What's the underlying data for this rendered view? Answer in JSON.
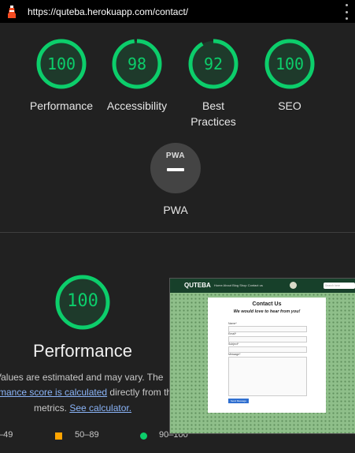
{
  "topbar": {
    "url": "https://quteba.herokuapp.com/contact/",
    "icon": "lighthouse-icon",
    "menu_icon": "kebab-menu-icon"
  },
  "gauges": [
    {
      "score": "100",
      "label": "Performance"
    },
    {
      "score": "98",
      "label": "Accessibility"
    },
    {
      "score": "92",
      "label_line1": "Best",
      "label_line2": "Practices"
    },
    {
      "score": "100",
      "label": "SEO"
    }
  ],
  "pwa": {
    "badge": "PWA",
    "label": "PWA"
  },
  "performance": {
    "score": "100",
    "title": "Performance",
    "note_line1": "Values are estimated and may vary. The",
    "note_line2_link": "mance score is calculated",
    "note_line2_rest": " directly from th",
    "note_line3_pre": "metrics. ",
    "note_line3_link": "See calculator."
  },
  "legend": {
    "fail": "–49",
    "average": "50–89",
    "pass": "90–100"
  },
  "colors": {
    "pass": "#0cce6b",
    "average": "#ffa400",
    "background": "#212121",
    "link": "#8ab4f8"
  },
  "screenshot": {
    "brand": "QUTEBA",
    "nav": "Home  About  Blog  Shop  Contact us",
    "search_placeholder": "Search here",
    "heading": "Contact Us",
    "subheading": "We would love to hear from you!",
    "fields": [
      "Name*",
      "Email*",
      "Subject*",
      "Message*"
    ],
    "button": "Send Message"
  }
}
